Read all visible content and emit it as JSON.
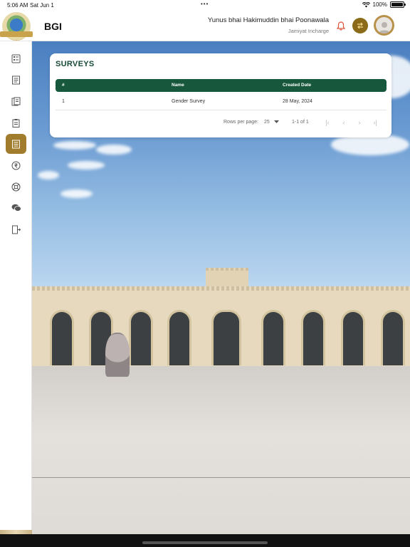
{
  "status_bar": {
    "time": "5:06 AM",
    "date": "Sat Jun 1",
    "battery": "100%"
  },
  "header": {
    "app_title": "BGI",
    "user_name": "Yunus bhai Hakimuddin bhai Poonawala",
    "user_role": "Jamiyat Incharge"
  },
  "sidebar": {
    "items": [
      {
        "icon": "dashboard-form-icon",
        "active": false
      },
      {
        "icon": "document-list-icon",
        "active": false
      },
      {
        "icon": "reports-icon",
        "active": false
      },
      {
        "icon": "clipboard-icon",
        "active": false
      },
      {
        "icon": "survey-list-icon",
        "active": true
      },
      {
        "icon": "currency-icon",
        "active": false
      },
      {
        "icon": "support-icon",
        "active": false
      },
      {
        "icon": "chat-icon",
        "active": false
      },
      {
        "icon": "logout-icon",
        "active": false
      }
    ]
  },
  "surveys": {
    "title": "SURVEYS",
    "columns": [
      "#",
      "Name",
      "Created Date"
    ],
    "rows": [
      {
        "index": "1",
        "name": "Gender Survey",
        "created": "28 May, 2024"
      }
    ],
    "pagination": {
      "rows_per_page_label": "Rows per page:",
      "rows_per_page_value": "25",
      "range": "1-1 of 1"
    }
  },
  "colors": {
    "primary_green": "#17573b",
    "accent_gold": "#a17c2c",
    "bell_red": "#e0523a"
  }
}
